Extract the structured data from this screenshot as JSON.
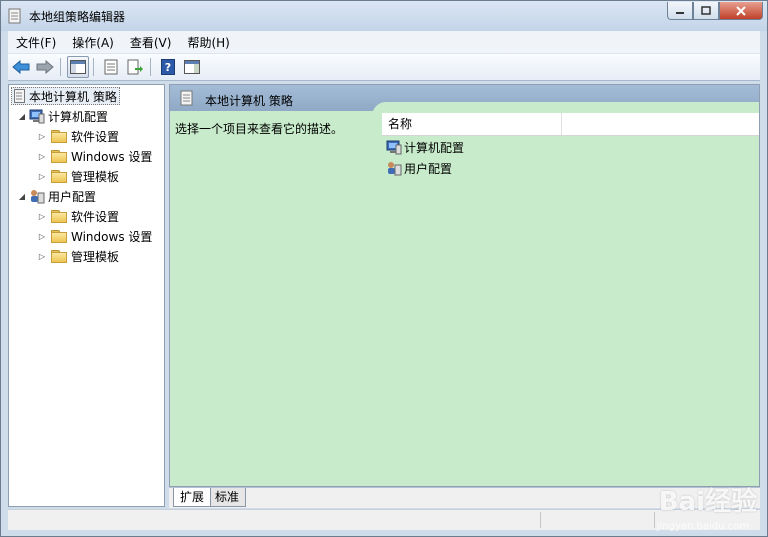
{
  "window": {
    "title": "本地组策略编辑器"
  },
  "menu": [
    "文件(F)",
    "操作(A)",
    "查看(V)",
    "帮助(H)"
  ],
  "toolbar": {
    "icons": [
      "back-arrow-icon",
      "forward-arrow-icon",
      "show-tree-icon",
      "properties-icon",
      "export-list-icon",
      "help-icon",
      "show-action-pane-icon"
    ]
  },
  "tree": {
    "root": "本地计算机 策略",
    "computer": {
      "label": "计算机配置",
      "children": [
        "软件设置",
        "Windows 设置",
        "管理模板"
      ]
    },
    "user": {
      "label": "用户配置",
      "children": [
        "软件设置",
        "Windows 设置",
        "管理模板"
      ]
    }
  },
  "right": {
    "header": "本地计算机 策略",
    "description": "选择一个项目来查看它的描述。",
    "column": "名称",
    "items": [
      "计算机配置",
      "用户配置"
    ]
  },
  "tabs": [
    "扩展",
    "标准"
  ],
  "watermark": {
    "brand": "Bai经验",
    "url": "jingyan.baidu.com"
  }
}
